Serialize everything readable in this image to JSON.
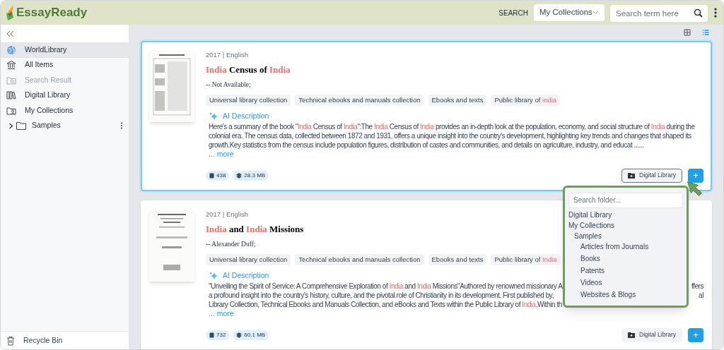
{
  "app": {
    "name": "EssayReady"
  },
  "search": {
    "label": "SEARCH",
    "scope": "My Collections",
    "placeholder": "Search term here"
  },
  "sidebar": {
    "items": [
      {
        "label": "WorldLibrary",
        "kind": "globe",
        "selected": true,
        "disabled": false
      },
      {
        "label": "All Items",
        "kind": "bank",
        "selected": false,
        "disabled": false
      },
      {
        "label": "Search Result",
        "kind": "search-folder",
        "selected": false,
        "disabled": true
      },
      {
        "label": "Digital Library",
        "kind": "books",
        "selected": false,
        "disabled": false
      },
      {
        "label": "My Collections",
        "kind": "folder-user",
        "selected": false,
        "disabled": false
      }
    ],
    "tree": [
      {
        "label": "Samples",
        "expanded": false
      }
    ],
    "footer": {
      "label": "Recycle Bin"
    }
  },
  "view_modes": [
    {
      "kind": "grid",
      "selected": false
    },
    {
      "kind": "list",
      "selected": true
    }
  ],
  "results": [
    {
      "selected": true,
      "meta": "2017 | English",
      "title": [
        {
          "text": "India",
          "highlight": true
        },
        {
          "text": " Census of ",
          "highlight": false
        },
        {
          "text": "India",
          "highlight": true
        }
      ],
      "author": "-- Not Available;",
      "tags": [
        [
          {
            "text": "Universal library collection",
            "highlight": false
          }
        ],
        [
          {
            "text": "Technical ebooks and manuals collection",
            "highlight": false
          }
        ],
        [
          {
            "text": "Ebooks and texts",
            "highlight": false
          }
        ],
        [
          {
            "text": "Public library of ",
            "highlight": false
          },
          {
            "text": "india",
            "highlight": true
          }
        ]
      ],
      "ai_label": "AI Description",
      "description": [
        {
          "text": "Here's a summary of the book \"",
          "highlight": false
        },
        {
          "text": "India",
          "highlight": true
        },
        {
          "text": " Census of ",
          "highlight": false
        },
        {
          "text": "India",
          "highlight": true
        },
        {
          "text": "\":The ",
          "highlight": false
        },
        {
          "text": "India",
          "highlight": true
        },
        {
          "text": " Census of ",
          "highlight": false
        },
        {
          "text": "India",
          "highlight": true
        },
        {
          "text": " provides an in-depth look at the population, economy, and social structure of ",
          "highlight": false
        },
        {
          "text": "India",
          "highlight": true
        },
        {
          "text": " during the colonial era. The census data, collected between 1872 and 1931, offers a unique insight into the country's development, highlighting key trends and changes that shaped its growth.Key statistics from the census include population figures, distribution of castes and communities, and details on agriculture, industry, and educat ......",
          "highlight": false
        }
      ],
      "more": "... more",
      "pages": "438",
      "size": "28.3 MB",
      "folder_label": "Digital Library",
      "folder_open": true,
      "add_label": "+"
    },
    {
      "selected": false,
      "meta": "2017 | English",
      "title": [
        {
          "text": "India",
          "highlight": true
        },
        {
          "text": " and ",
          "highlight": false
        },
        {
          "text": "India",
          "highlight": true
        },
        {
          "text": " Missions",
          "highlight": false
        }
      ],
      "author": "-- Alexander Duff;",
      "tags": [
        [
          {
            "text": "Universal library collection",
            "highlight": false
          }
        ],
        [
          {
            "text": "Technical ebooks and manuals collection",
            "highlight": false
          }
        ],
        [
          {
            "text": "Ebooks and texts",
            "highlight": false
          }
        ],
        [
          {
            "text": "Public library of ",
            "highlight": false
          },
          {
            "text": "India",
            "highlight": true
          }
        ]
      ],
      "ai_label": "AI Description",
      "description_lines": [
        {
          "segments": [
            {
              "text": "\"Unveiling the Spirit of Service: A Comprehensive Exploration of ",
              "highlight": false
            },
            {
              "text": "India",
              "highlight": true
            },
            {
              "text": " and ",
              "highlight": false
            },
            {
              "text": "India",
              "highlight": true
            },
            {
              "text": " Missions\"Authored by renowned missionary A",
              "highlight": false
            }
          ],
          "tail": "ffers"
        },
        {
          "segments": [
            {
              "text": "a profound insight into the country's history, culture, and the pivotal role of Christianity in its development. First published by,",
              "highlight": false
            }
          ],
          "tail": "al"
        },
        {
          "segments": [
            {
              "text": "Library Collection, Technical Ebooks and Manuals Collection, and eBooks and Texts within the Public Library of ",
              "highlight": false
            },
            {
              "text": "India",
              "highlight": true
            },
            {
              "text": ".Within th",
              "highlight": false
            }
          ]
        }
      ],
      "more": "... more",
      "pages": "732",
      "size": "60.1 MB",
      "folder_label": "Digital Library",
      "folder_open": false,
      "add_label": "+"
    }
  ],
  "folder_menu": {
    "placeholder": "Search folder...",
    "folders": [
      {
        "label": "Digital Library"
      },
      {
        "label": "My Collections",
        "children": [
          {
            "label": "Samples",
            "children": [
              {
                "label": "Articles from Journals"
              },
              {
                "label": "Books"
              },
              {
                "label": "Patents"
              },
              {
                "label": "Videos"
              },
              {
                "label": "Websites & Blogs"
              }
            ]
          }
        ]
      }
    ]
  }
}
